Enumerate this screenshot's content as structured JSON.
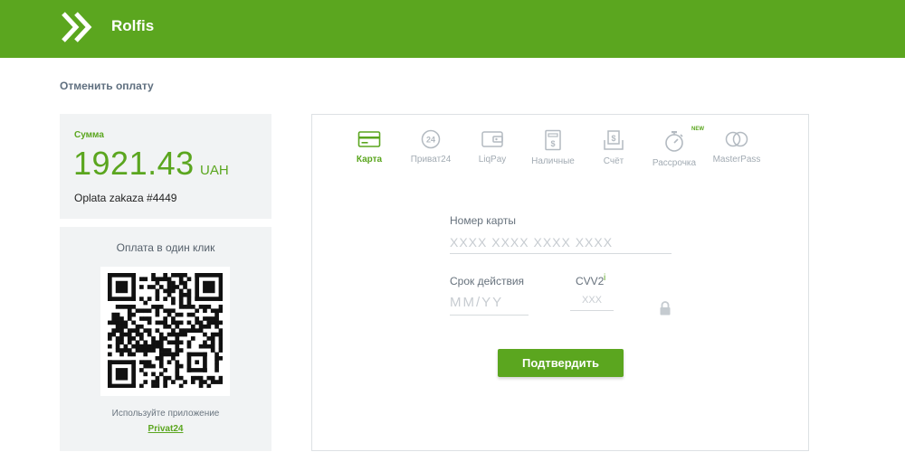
{
  "header": {
    "brand": "Rolfis",
    "logo_icon": "double-chevron-right-icon"
  },
  "cancel_label": "Отменить оплату",
  "amount": {
    "label": "Сумма",
    "value": "1921.43",
    "currency": "UAH",
    "description": "Oplata zakaza #4449"
  },
  "qr": {
    "title": "Оплата в один клик",
    "caption": "Используйте приложение",
    "link": "Privat24"
  },
  "tabs": [
    {
      "label": "Карта",
      "icon": "credit-card-icon",
      "active": true
    },
    {
      "label": "Приват24",
      "icon": "privat24-icon",
      "active": false
    },
    {
      "label": "LiqPay",
      "icon": "wallet-icon",
      "active": false
    },
    {
      "label": "Наличные",
      "icon": "cash-terminal-icon",
      "active": false
    },
    {
      "label": "Счёт",
      "icon": "invoice-icon",
      "active": false
    },
    {
      "label": "Рассрочка",
      "icon": "stopwatch-icon",
      "active": false,
      "badge": "NEW"
    },
    {
      "label": "MasterPass",
      "icon": "masterpass-icon",
      "active": false
    }
  ],
  "form": {
    "card_label": "Номер карты",
    "card_placeholder": "XXXX XXXX XXXX XXXX",
    "expiry_label": "Срок действия",
    "expiry_placeholder": "MM/YY",
    "cvv_label": "CVV2",
    "cvv_info": "i",
    "cvv_placeholder": "XXX",
    "submit_label": "Подтвердить"
  },
  "colors": {
    "accent": "#5ba61f",
    "panel_bg": "#f1f3f4",
    "muted_icon": "#b3bac1"
  }
}
